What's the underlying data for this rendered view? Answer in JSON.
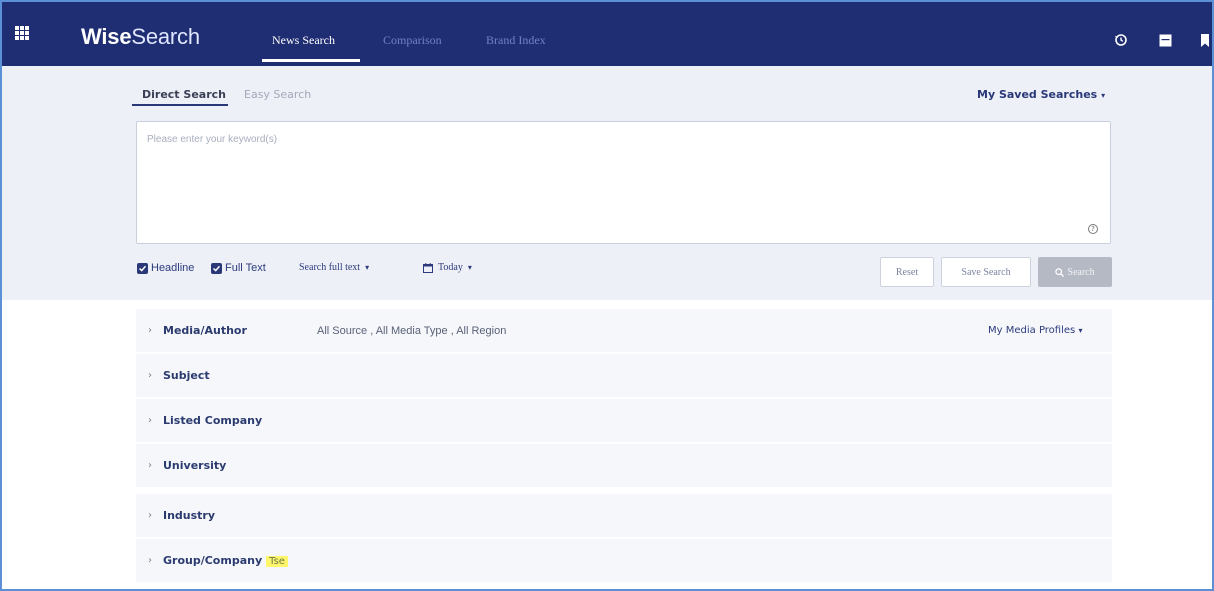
{
  "topbar": {
    "logo_bold": "Wise",
    "logo_light": "Search",
    "tabs": [
      {
        "label": "News Search",
        "active": true
      },
      {
        "label": "Comparison",
        "active": false
      },
      {
        "label": "Brand Index",
        "active": false
      }
    ],
    "icons": [
      "history-icon",
      "panel-icon",
      "bookmark-icon"
    ]
  },
  "search": {
    "subtabs": [
      {
        "label": "Direct Search",
        "active": true
      },
      {
        "label": "Easy Search",
        "active": false
      }
    ],
    "saved_searches_label": "My Saved Searches",
    "keyword_placeholder": "Please enter your keyword(s)",
    "keyword_value": "",
    "options": {
      "headline_label": "Headline",
      "headline_checked": true,
      "fulltext_label": "Full Text",
      "fulltext_checked": true,
      "search_mode": "Search full text",
      "date_range": "Today"
    },
    "buttons": {
      "reset": "Reset",
      "save": "Save Search",
      "search": "Search"
    }
  },
  "filters": [
    {
      "label": "Media/Author",
      "value": "All Source , All Media Type , All Region",
      "profiles": "My Media Profiles"
    },
    {
      "label": "Subject",
      "value": ""
    },
    {
      "label": "Listed Company",
      "value": ""
    },
    {
      "label": "University",
      "value": ""
    },
    {
      "label": "Industry",
      "value": ""
    },
    {
      "label": "Group/Company",
      "value": "",
      "badge": "Tse"
    }
  ],
  "colors": {
    "nav_bg": "#1f2d72",
    "panel_bg": "#edf0f7",
    "accent": "#2a3878",
    "highlight": "#fff66c"
  }
}
